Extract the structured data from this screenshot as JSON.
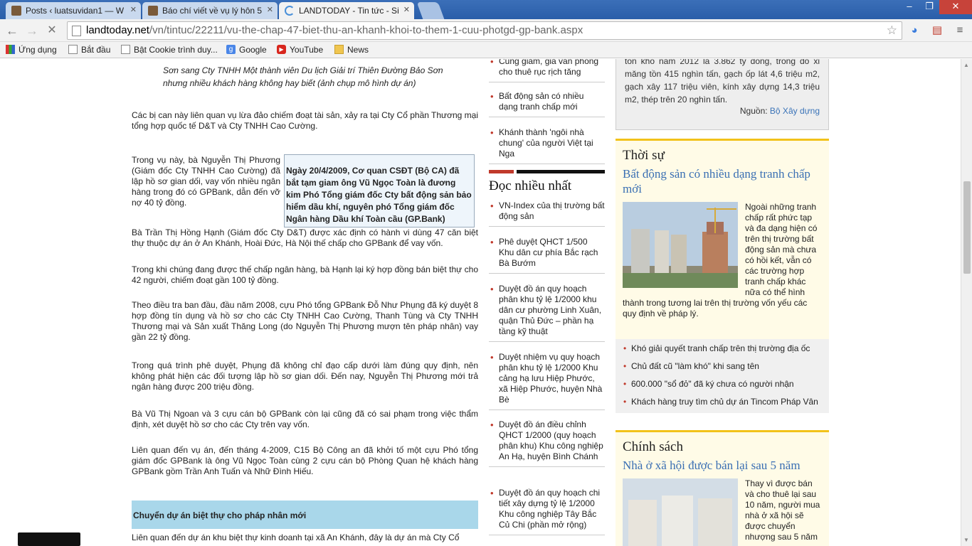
{
  "browser": {
    "tabs": [
      {
        "title": "Posts ‹ luatsuvidan1 — W",
        "active": false
      },
      {
        "title": "Báo chí viết về vụ lý hôn 5",
        "active": false
      },
      {
        "title": "LANDTODAY - Tin tức - Si",
        "active": true
      }
    ],
    "url_host": "landtoday.net",
    "url_path": "/vn/tintuc/22211/vu-the-chap-47-biet-thu-an-khanh-khoi-to-them-1-cuu-photgd-gp-bank.aspx",
    "bookmarks": [
      "Ứng dụng",
      "Bắt đầu",
      "Bật Cookie trình duy...",
      "Google",
      "YouTube",
      "News"
    ]
  },
  "article": {
    "caption": "Sơn sang Cty TNHH Một thành viên Du lịch Giải trí Thiên Đường Bảo Sơn nhưng nhiều khách hàng không hay biết (ảnh chụp mô hình dự án)",
    "paragraphs": [
      "Các bị can này liên quan vụ lừa đảo chiếm đoạt tài sản, xảy ra tại Cty Cổ phần Thương mại tổng hợp quốc tế D&T và Cty TNHH Cao Cường.",
      "Trong vụ này, bà Nguyễn Thị Phương (Giám đốc Cty TNHH Cao Cường) đã lập hồ sơ gian dối, vay vốn nhiều ngân hàng trong đó có GPBank, dẫn đến vỡ nợ 40 tỷ đồng.",
      "Bà Trần Thị Hồng Hạnh (Giám đốc Cty D&T) được xác định có hành vi dùng 47 căn biệt thự thuộc dự án ở An Khánh, Hoài Đức, Hà Nội thế chấp cho GPBank để vay vốn.",
      "Trong khi chúng đang được thế chấp ngân hàng, bà Hạnh lại ký hợp đồng bán biệt thự cho 42 người, chiếm đoạt gần 100 tỷ đồng.",
      "Theo điều tra ban đầu, đầu năm 2008, cựu Phó tổng GPBank Đỗ Như Phụng đã ký duyệt 8 hợp đồng tín dụng và hồ sơ cho các Cty TNHH Cao Cường, Thanh Tùng và Cty TNHH Thương mại và Sản xuất Thăng Long (do Nguyễn Thị Phương mượn tên pháp nhân) vay gần 22 tỷ đồng.",
      "Trong quá trình phê duyệt, Phụng đã không chỉ đạo cấp dưới làm đúng quy định, nên không phát hiện các đối tượng lập hồ sơ gian dối. Đến nay, Nguyễn Thị Phương mới trả ngân hàng được 200 triệu đồng.",
      "Bà Vũ Thị Ngoan và 3 cựu cán bộ GPBank còn lại cũng đã có sai phạm trong việc thẩm định, xét duyệt hồ sơ cho các Cty trên vay vốn.",
      "Liên quan đến vụ án, đến tháng 4-2009, C15 Bộ Công an đã khởi tố một cựu Phó tổng giám đốc GPBank là ông Vũ Ngọc Toàn cùng 2 cựu cán bộ Phòng Quan hệ khách hàng GPBank gồm Trần Anh Tuấn và Nhữ Đình Hiếu."
    ],
    "quote": "Ngày 20/4/2009, Cơ quan CSĐT (Bộ CA) đã bắt tạm giam ông Vũ Ngọc Toàn là đương kim Phó Tổng giám đốc Cty bất động sản bảo hiểm dầu khí, nguyên phó Tổng giám đốc Ngân hàng Dầu khí Toàn cầu (GP.Bank)",
    "subhead": "Chuyển dự án biệt thự cho pháp nhân mới",
    "subhead_after": "Liên quan đến dự án khu biệt thự kinh doanh tại xã An Khánh, đây là dự án mà Cty Cổ"
  },
  "middle": {
    "top_items": [
      "Cung giảm, giá văn phòng cho thuê rục rịch tăng",
      "Bất động sản có nhiều dạng tranh chấp mới",
      "Khánh thành 'ngôi nhà chung' của người Việt tại Nga"
    ],
    "most_read_title": "Đọc nhiều nhất",
    "most_read": [
      "VN-Index của thị trường bất động sản",
      "Phê duyệt QHCT 1/500 Khu dân cư phía Bắc rạch Bà Bướm",
      "Duyệt đồ án quy hoạch phân khu tỷ lệ 1/2000 khu dân cư phường Linh Xuân, quận Thủ Đức – phần hạ tầng kỹ thuật",
      "Duyệt nhiệm vụ quy hoạch phân khu tỷ lệ 1/2000 Khu cảng hạ lưu Hiệp Phước, xã Hiệp Phước, huyện Nhà Bè",
      "Duyệt đồ án điều chỉnh QHCT 1/2000 (quy hoạch phân khu) Khu công nghiệp An Hạ, huyện Bình Chánh",
      "Duyệt đồ án quy hoạch chi tiết xây dựng tỷ lệ 1/2000 Khu công nghiệp Tây Bắc Củ Chi (phần mở rộng)"
    ]
  },
  "right": {
    "stat_text": "tồn kho năm 2012 là 3.862 tỷ đồng, trong đó xi măng tồn 415 nghìn tấn, gạch ốp lát 4,6 triệu m2, gạch xây 117 triệu viên, kính xây dựng 14,3 triệu m2, thép trên 20 nghìn tấn.",
    "source_label": "Nguồn:",
    "source_link": "Bộ Xây dựng",
    "thoisu": {
      "title": "Thời sự",
      "headline": "Bất động sản có nhiều dạng tranh chấp mới",
      "body": "Ngoài những tranh chấp rất phức tạp và đa dạng hiện có trên thị trường bất động sản mà chưa có hồi kết, vẫn có các trường hợp tranh chấp khác nữa có thể hình thành trong tương lai trên thị trường vốn yếu các quy định về pháp lý.",
      "links": [
        "Khó giải quyết tranh chấp trên thị trường địa ốc",
        "Chủ đất cũ \"làm khó\" khi sang tên",
        "600.000 \"sổ đỏ\" đã ký chưa có người nhận",
        "Khách hàng truy tìm chủ dự án Tincom Pháp Vân"
      ]
    },
    "chinhsach": {
      "title": "Chính sách",
      "headline": "Nhà ở xã hội được bán lại sau 5 năm",
      "body": "Thay vì được bán và cho thuê lại sau 10 năm, người mua nhà ở xã hội sẽ được chuyển nhượng sau 5 năm"
    }
  }
}
